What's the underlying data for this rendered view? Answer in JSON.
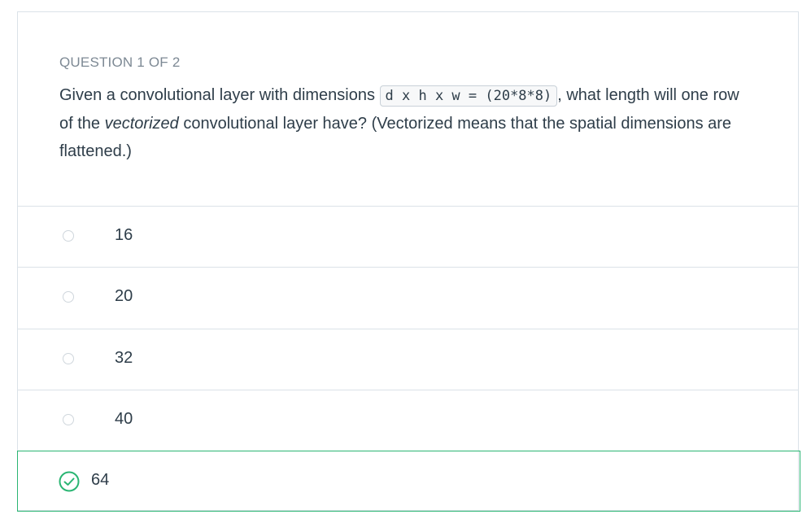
{
  "question": {
    "header": "QUESTION 1 OF 2",
    "text_before": "Given a convolutional layer with dimensions ",
    "code": "d x h x w = (20*8*8)",
    "text_mid": ", what length will one row of the ",
    "emphasis": "vectorized",
    "text_after": " convolutional layer have? (Vectorized means that the spatial dimensions are flattened.)"
  },
  "options": [
    {
      "label": "16",
      "selected": false
    },
    {
      "label": "20",
      "selected": false
    },
    {
      "label": "32",
      "selected": false
    },
    {
      "label": "40",
      "selected": false
    },
    {
      "label": "64",
      "selected": true
    }
  ],
  "colors": {
    "correct": "#2ab573",
    "text": "#2e3d49",
    "header": "#7d8994"
  },
  "icons": {
    "unselected": "radio-icon",
    "selected": "check-circle-icon"
  }
}
